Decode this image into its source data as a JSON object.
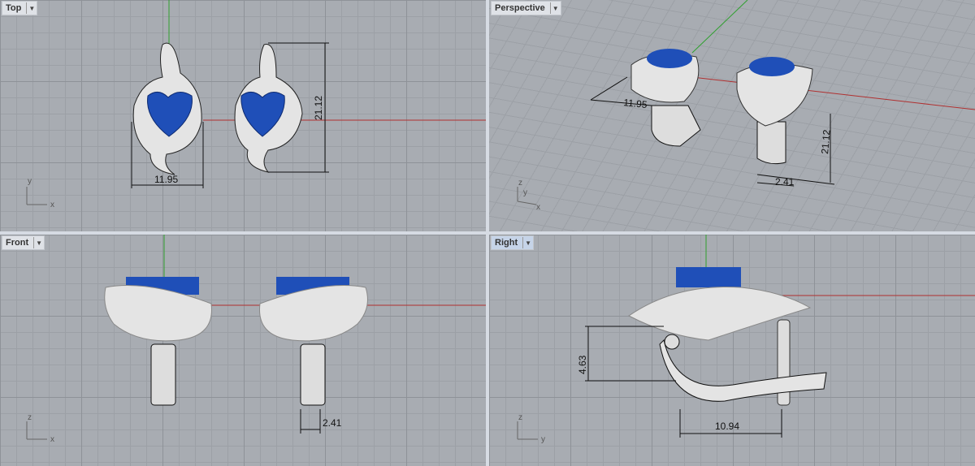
{
  "viewports": [
    {
      "name": "Top",
      "dims": [
        "11.95",
        "21.12"
      ],
      "axes": [
        "y",
        "x"
      ]
    },
    {
      "name": "Perspective",
      "dims": [
        "11.95",
        "21.12",
        "2.41"
      ],
      "axes": [
        "z",
        "y",
        "x"
      ]
    },
    {
      "name": "Front",
      "dims": [
        "2.41"
      ],
      "axes": [
        "z",
        "x"
      ]
    },
    {
      "name": "Right",
      "dims": [
        "4.63",
        "10.94"
      ],
      "axes": [
        "z",
        "y"
      ]
    }
  ],
  "dropdown_icon": "triangle-down",
  "colors": {
    "viewport_bg": "#a8acb2",
    "gem": "#1f4fb8",
    "x_axis": "#b03030",
    "y_axis": "#2fa02f"
  }
}
